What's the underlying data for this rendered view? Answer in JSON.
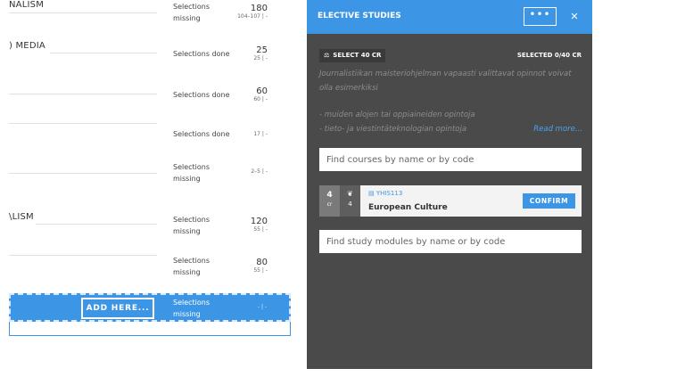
{
  "plan": {
    "rows": [
      {
        "name": "NALISM",
        "status": "Selections missing",
        "credits": "180",
        "range": "104–107 | -"
      },
      {
        "name": ") MEDIA",
        "status": "Selections done",
        "credits": "25",
        "range": "25 | -"
      },
      {
        "name": "",
        "status": "Selections done",
        "credits": "60",
        "range": "60 | -"
      },
      {
        "name": "",
        "status": "Selections done",
        "credits": "",
        "range": "17 | -"
      },
      {
        "name": "",
        "status": "Selections missing",
        "credits": "",
        "range": "2–5 | -"
      },
      {
        "name": "\\LISM",
        "status": "Selections missing",
        "credits": "120",
        "range": "55 | -"
      },
      {
        "name": "",
        "status": "Selections missing",
        "credits": "80",
        "range": "55 | -"
      }
    ],
    "dropzone": {
      "add_label": "ADD HERE...",
      "status": "Selections missing",
      "range": "- | -"
    }
  },
  "panel": {
    "title": "ELECTIVE STUDIES",
    "more_label": "•••",
    "close_label": "✕",
    "select_tag": "SELECT 40 CR",
    "selected_count": "SELECTED 0/40 CR",
    "description": "Journalistiikan maisteriohjelman vapaasti valittavat opinnot voivat olla esimerkiksi",
    "bullets": [
      "- muiden alojen tai oppiaineiden opintoja",
      "- tieto- ja viestintäteknologian opintoja"
    ],
    "read_more": "Read more...",
    "course_search_placeholder": "Find courses by name or by code",
    "module_search_placeholder": "Find study modules by name or by code",
    "course": {
      "credits": "4",
      "credits_unit": "cr",
      "other_value": "4",
      "code": "YHIS113",
      "name": "European Culture",
      "confirm_label": "CONFIRM"
    }
  },
  "colors": {
    "accent": "#3d96e5",
    "panel_bg": "#4a4a4a"
  }
}
